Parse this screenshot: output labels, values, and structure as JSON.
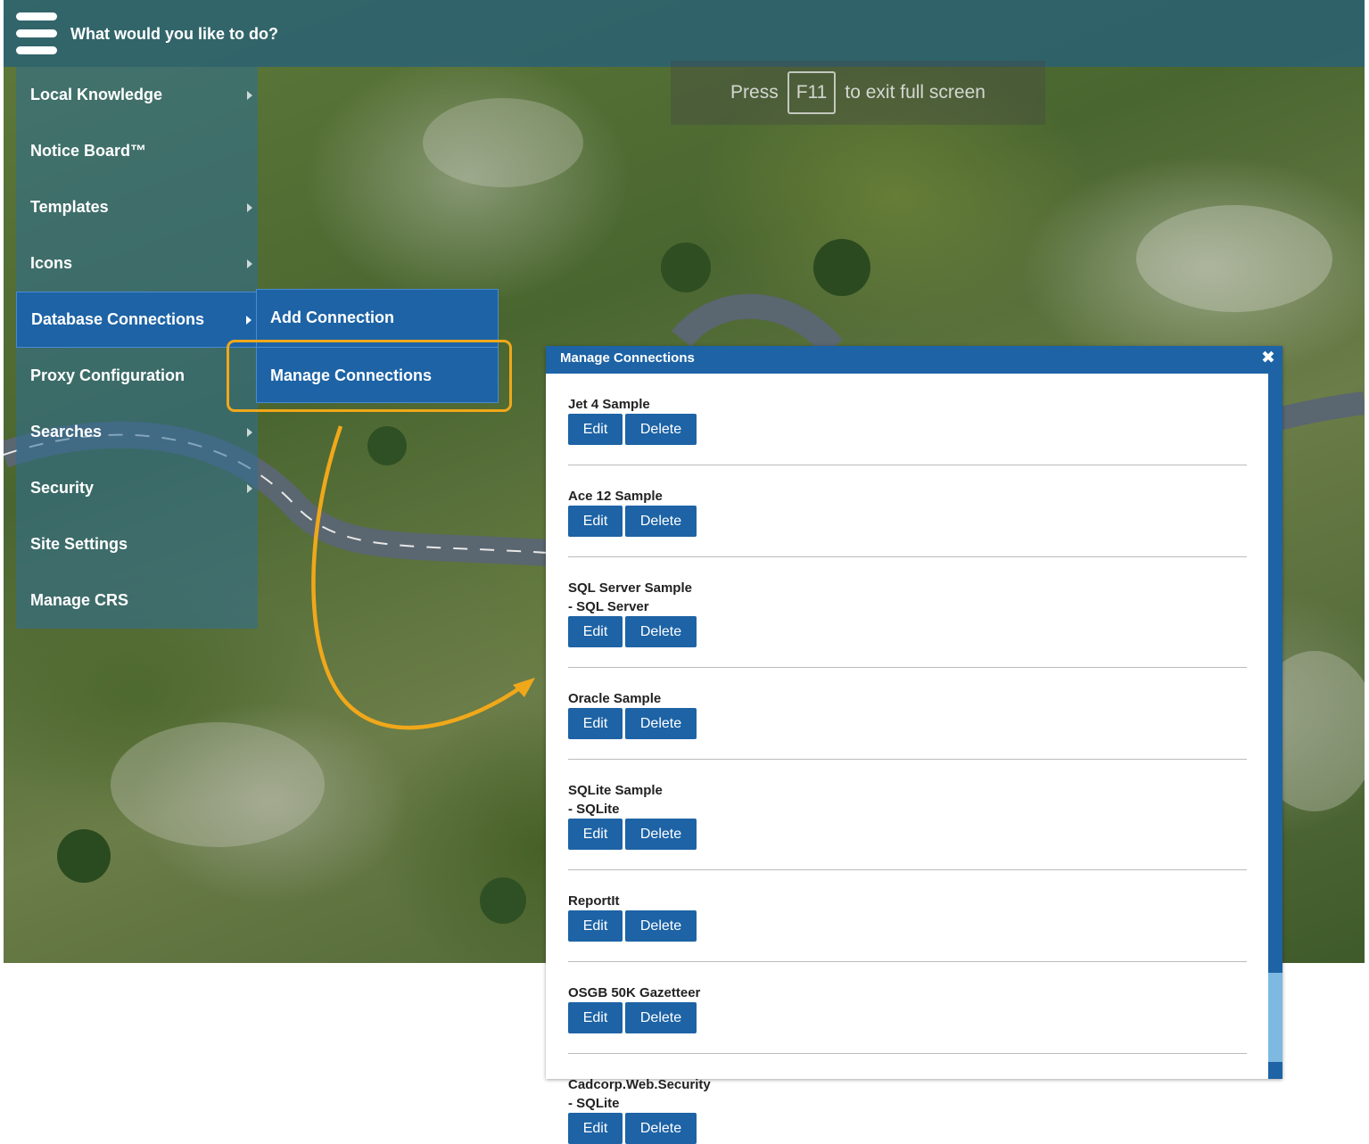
{
  "topbar": {
    "title": "What would you like to do?"
  },
  "fullscreen_hint": {
    "before": "Press",
    "key": "F11",
    "after": "to exit full screen"
  },
  "side_menu": {
    "items": [
      {
        "label": "Local Knowledge",
        "has_arrow": true
      },
      {
        "label": "Notice Board™",
        "has_arrow": false
      },
      {
        "label": "Templates",
        "has_arrow": true
      },
      {
        "label": "Icons",
        "has_arrow": true
      },
      {
        "label": "Database Connections",
        "has_arrow": true,
        "active": true
      },
      {
        "label": "Proxy Configuration",
        "has_arrow": false
      },
      {
        "label": "Searches",
        "has_arrow": true
      },
      {
        "label": "Security",
        "has_arrow": true
      },
      {
        "label": "Site Settings",
        "has_arrow": false
      },
      {
        "label": "Manage CRS",
        "has_arrow": false
      }
    ]
  },
  "submenu": {
    "add": "Add Connection",
    "manage": "Manage Connections"
  },
  "dialog": {
    "title": "Manage Connections",
    "close_icon": "✖",
    "edit_label": "Edit",
    "delete_label": "Delete",
    "connections": [
      {
        "name": "Jet 4 Sample"
      },
      {
        "name": "Ace 12 Sample"
      },
      {
        "name": "SQL Server Sample\n- SQL Server"
      },
      {
        "name": "Oracle Sample"
      },
      {
        "name": "SQLite Sample\n- SQLite"
      },
      {
        "name": "ReportIt"
      },
      {
        "name": "OSGB 50K Gazetteer"
      },
      {
        "name": "Cadcorp.Web.Security\n- SQLite"
      }
    ]
  },
  "colors": {
    "menu_blue": "#1d63a5",
    "highlight": "#f0a81a",
    "scroll_thumb": "#7db9e0"
  }
}
